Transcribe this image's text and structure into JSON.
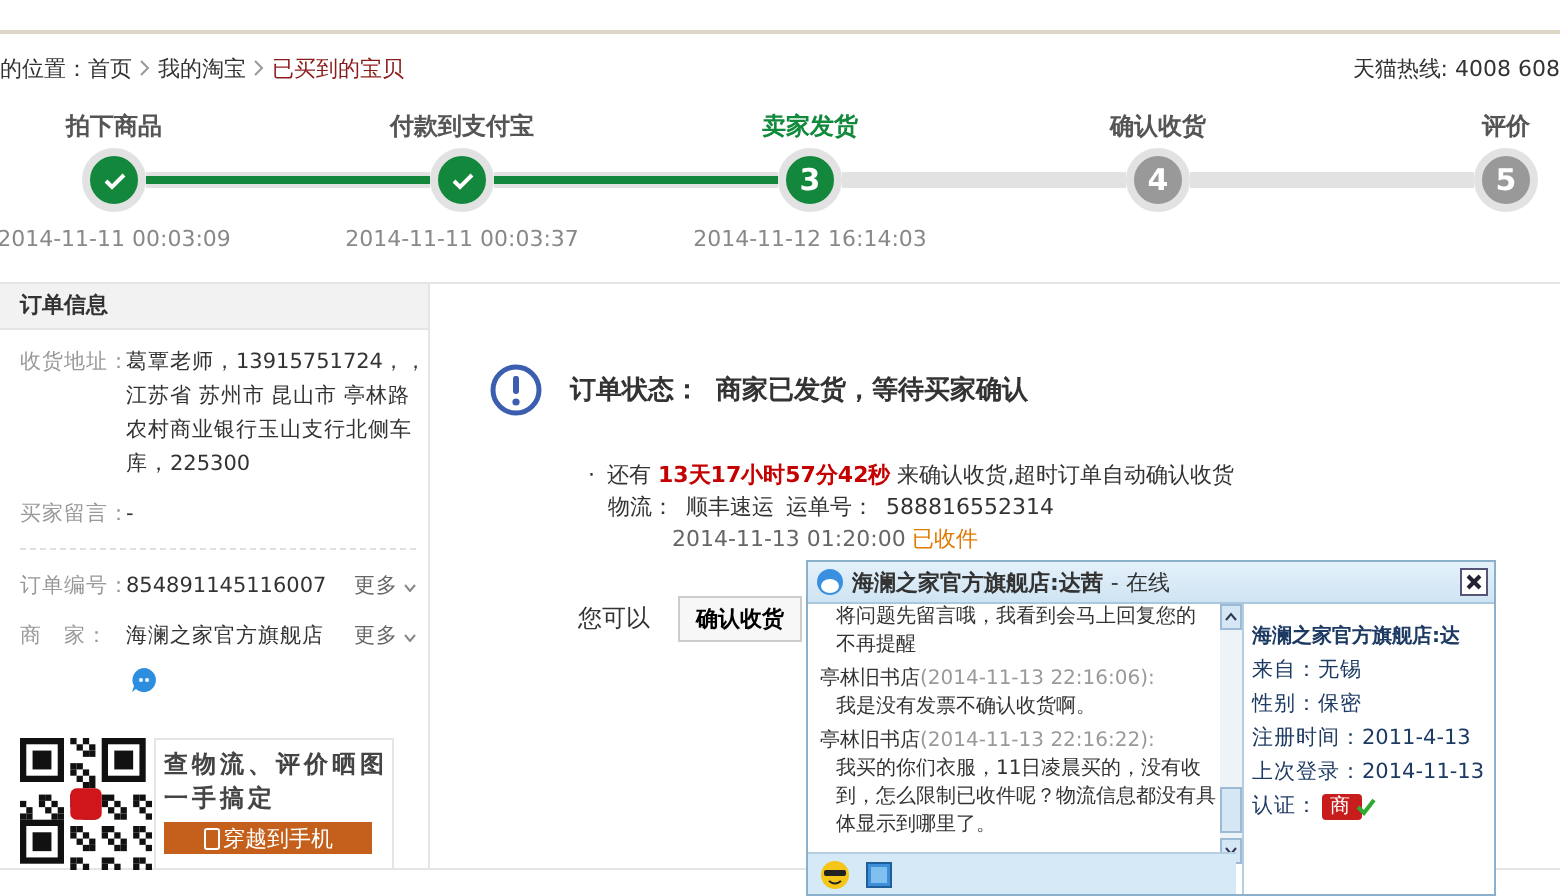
{
  "breadcrumb": {
    "label": "的位置：",
    "items": [
      {
        "text": "首页",
        "selected": false
      },
      {
        "text": "我的淘宝",
        "selected": false
      },
      {
        "text": "已买到的宝贝",
        "selected": true
      }
    ]
  },
  "hotline": "天猫热线: 4008 608",
  "steps": [
    {
      "label": "拍下商品",
      "done": true,
      "current": false,
      "time": "2014-11-11 00:03:09"
    },
    {
      "label": "付款到支付宝",
      "done": true,
      "current": false,
      "time": "2014-11-11 00:03:37"
    },
    {
      "label": "卖家发货",
      "done": false,
      "current": true,
      "number": "3",
      "time": "2014-11-12 16:14:03"
    },
    {
      "label": "确认收货",
      "done": false,
      "current": false,
      "number": "4"
    },
    {
      "label": "评价",
      "done": false,
      "current": false,
      "number": "5"
    }
  ],
  "order_info": {
    "title": "订单信息",
    "fields": [
      {
        "label": "收货地址：",
        "lines": [
          "葛覃老师，13915751724，，",
          "江苏省 苏州市 昆山市 亭林路",
          "农村商业银行玉山支行北侧车",
          "库，225300"
        ]
      },
      {
        "label": "买家留言：",
        "value": "-"
      },
      {
        "label": "订单编号：",
        "value": "854891145116007",
        "more": "更多"
      },
      {
        "label": "商　家：",
        "value": "海澜之家官方旗舰店",
        "more": "更多"
      }
    ],
    "promo": {
      "line1": "查物流、评价晒图",
      "line2": "一手搞定",
      "button": "穿越到手机"
    }
  },
  "status": {
    "label": "订单状态：",
    "text": "商家已发货，等待买家确认",
    "bullet": "·",
    "countdown": "还有 **13天17小时57分42秒** 来确认收货,超时订单自动确认收货",
    "logistics_label": "物流：",
    "carrier": "顺丰速运",
    "waybill_label": "运单号：",
    "waybill": "588816552314",
    "track_time": "2014-11-13 01:20:00",
    "track_status": "已收件",
    "action_label": "您可以",
    "action_button": "确认收货"
  },
  "chat": {
    "title": "海澜之家官方旗舰店:达茜",
    "presence": "- 在线",
    "messages": [
      {
        "kind": "text",
        "text": "将问题先留言哦，我看到会马上回复您的"
      },
      {
        "kind": "text",
        "text": "不再提醒"
      },
      {
        "kind": "sender",
        "name": "亭林旧书店",
        "time": "(2014-11-13 22:16:06):"
      },
      {
        "kind": "text",
        "text": "我是没有发票不确认收货啊。"
      },
      {
        "kind": "sender",
        "name": "亭林旧书店",
        "time": "(2014-11-13 22:16:22):"
      },
      {
        "kind": "text",
        "text": "我买的你们衣服，11日凌晨买的，没有收到，怎么限制已收件呢？物流信息都没有具体显示到哪里了。"
      }
    ],
    "profile": {
      "name": "海澜之家官方旗舰店:达",
      "fields": [
        {
          "label": "来自：",
          "value": "无锡"
        },
        {
          "label": "性别：",
          "value": "保密"
        },
        {
          "label": "注册时间：",
          "value": "2011-4-13"
        },
        {
          "label": "上次登录：",
          "value": "2014-11-13"
        }
      ],
      "cert_label": "认证：",
      "cert_badge": "商"
    }
  }
}
